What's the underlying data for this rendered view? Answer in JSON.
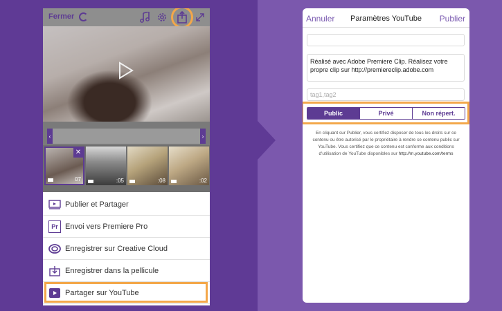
{
  "left": {
    "topbar": {
      "close_label": "Fermer",
      "icons": [
        "spinner-icon",
        "music-icon",
        "gear-icon",
        "share-icon",
        "expand-icon"
      ]
    },
    "thumbnails": [
      {
        "time": "07"
      },
      {
        "time": ":05"
      },
      {
        "time": ":08"
      },
      {
        "time": ":02"
      }
    ],
    "menu": [
      {
        "label": "Publier et Partager",
        "icon": "publish-icon"
      },
      {
        "label": "Envoi vers Premiere Pro",
        "icon": "premiere-pro-icon",
        "icon_text": "Pr"
      },
      {
        "label": "Enregistrer sur Creative Cloud",
        "icon": "creative-cloud-icon"
      },
      {
        "label": "Enregistrer dans la pellicule",
        "icon": "camera-roll-icon"
      },
      {
        "label": "Partager sur YouTube",
        "icon": "youtube-icon"
      }
    ]
  },
  "right": {
    "header": {
      "cancel_label": "Annuler",
      "title": "Paramètres YouTube",
      "publish_label": "Publier"
    },
    "title_field": {
      "value": ""
    },
    "description_field": {
      "value": "Réalisé avec Adobe Premiere Clip. Réalisez votre propre clip sur http://premiereclip.adobe.com"
    },
    "tags_field": {
      "placeholder": "tag1,tag2"
    },
    "privacy": {
      "options": [
        "Public",
        "Privé",
        "Non répert."
      ],
      "selected": "Public"
    },
    "legal": {
      "text": "En cliquant sur Publier, vous certifiez disposer de tous les droits sur ce contenu ou être autorisé par le propriétaire à rendre ce contenu public sur YouTube. Vous certifiez que ce contenu est conforme aux conditions d'utilisation de YouTube disponibles sur",
      "link": "http://m.youtube.com/terms"
    }
  },
  "colors": {
    "accent": "#5d3b93",
    "highlight": "#f3a74a",
    "bg_left": "#5f3a95",
    "bg_right": "#7b58ad"
  }
}
